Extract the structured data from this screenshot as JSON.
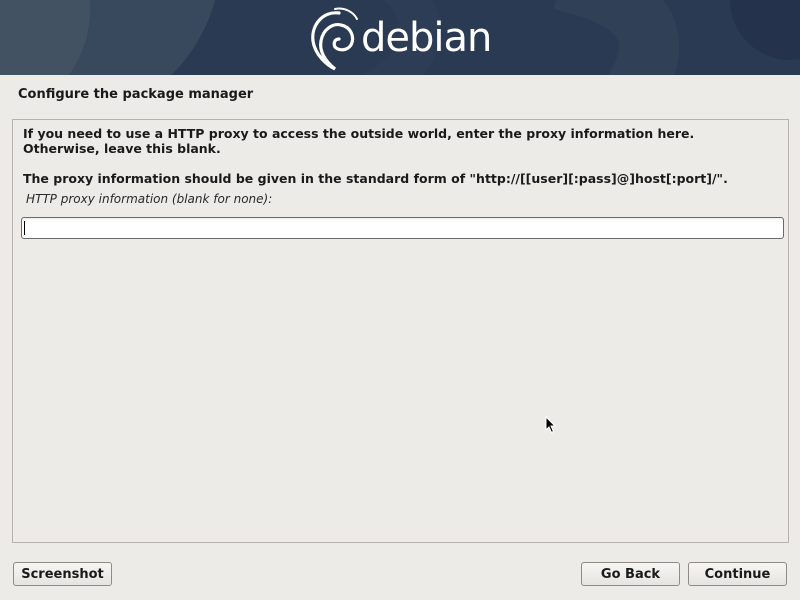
{
  "banner": {
    "logo_text": "debian",
    "logo_icon": "debian-swirl-icon",
    "colors": {
      "banner_bg": "#2a3a52",
      "accent": "#ffffff"
    }
  },
  "page": {
    "title": "Configure the package manager"
  },
  "content": {
    "paragraph_1_line_1": "If you need to use a HTTP proxy to access the outside world, enter the proxy information here.",
    "paragraph_1_line_2": "Otherwise, leave this blank.",
    "paragraph_2": "The proxy information should be given in the standard form of \"http://[[user][:pass]@]host[:port]/\".",
    "field_label": "HTTP proxy information (blank for none):",
    "proxy_input_value": "",
    "proxy_input_placeholder": ""
  },
  "buttons": {
    "screenshot": "Screenshot",
    "go_back": "Go Back",
    "continue": "Continue"
  },
  "pointer": {
    "icon": "mouse-pointer-icon"
  }
}
